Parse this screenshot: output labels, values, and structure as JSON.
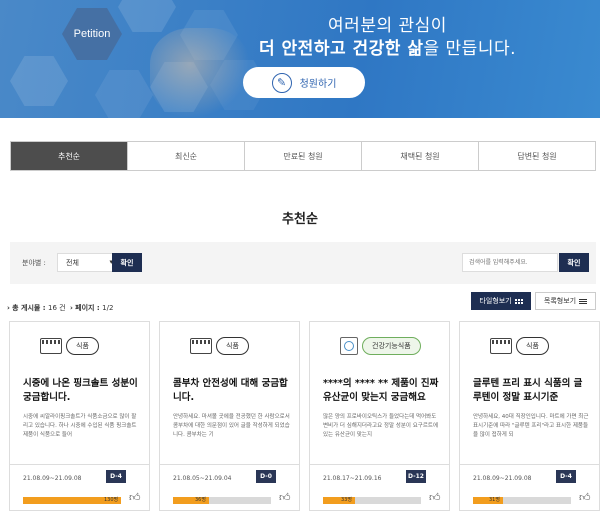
{
  "banner": {
    "badge_text": "Petition",
    "line1": "여러분의 관심이",
    "line2_bold": "더 안전하고 건강한 삶",
    "line2_rest": "을 만듭니다.",
    "button_label": "청원하기"
  },
  "tabs": [
    {
      "label": "추천순",
      "active": true
    },
    {
      "label": "최신순",
      "active": false
    },
    {
      "label": "만료된 청원",
      "active": false
    },
    {
      "label": "채택된 청원",
      "active": false
    },
    {
      "label": "답변된 청원",
      "active": false
    }
  ],
  "section_title": "추천순",
  "filter": {
    "field_label": "분야별 :",
    "select_value": "전체",
    "confirm_label": "확인",
    "search_placeholder": "검색어를 입력해주세요.",
    "search_confirm_label": "확인"
  },
  "summary": {
    "total_label": "총 게시물 : ",
    "total_value": "16 건",
    "page_label": "페이지 : ",
    "page_value": "1/2"
  },
  "view_toggle": {
    "tile_label": "타일형보기",
    "list_label": "목록형보기"
  },
  "cards": [
    {
      "category": "식품",
      "title": "시중에 나온 핑크솔트 성분이 궁금합니다.",
      "body": "시중에 씨알라이핑크솔트가 식품소금으로 많이 팔리고 있습니다. 하나 시중에 수입된 식품 핑크솔트제품이 식품으로 들어",
      "date": "21.08.09~21.09.08",
      "dday": "D-4",
      "progress": 1.0,
      "progress_label": "130명"
    },
    {
      "category": "식품",
      "title": "콤부차 안전성에 대해 궁금합니다.",
      "body": "안녕하세요. 마셔볼 곳에을 전공했던 한 사람으로서 콤부차에 대한 의문점이 있어 글을 작성하게 되었습니다. 콤부차는 기",
      "date": "21.08.05~21.09.04",
      "dday": "D-0",
      "progress": 0.37,
      "progress_label": "36명"
    },
    {
      "category": "건강기능식품",
      "title": "****의 **** ** 제품이 진짜 유산균이 맞는지 궁금해요",
      "body": "많은 양의 프로바이오틱스가 들었다는데 먹어봐도 변비가 더 심해지더라고요 정말 성분이 요구르트에 있는 유산균이 맞는지",
      "date": "21.08.17~21.09.16",
      "dday": "D-12",
      "progress": 0.33,
      "progress_label": "33명"
    },
    {
      "category": "식품",
      "title": "글루텐 프리 표시 식품의 글루텐이 정말 표시기준",
      "body": "안녕하세요, 40대 직장인입니다. 마트에 가면 최근 표시기준에 따라 \"글루텐 프리\"라고 표시한 제품들을 많이 접하게 되",
      "date": "21.08.09~21.09.08",
      "dday": "D-4",
      "progress": 0.31,
      "progress_label": "31명"
    }
  ],
  "colors": {
    "banner_blue": "#3a7fc6",
    "navy": "#1e2e52",
    "progress_orange": "#f29d1e",
    "active_tab": "#4d4d4d"
  }
}
